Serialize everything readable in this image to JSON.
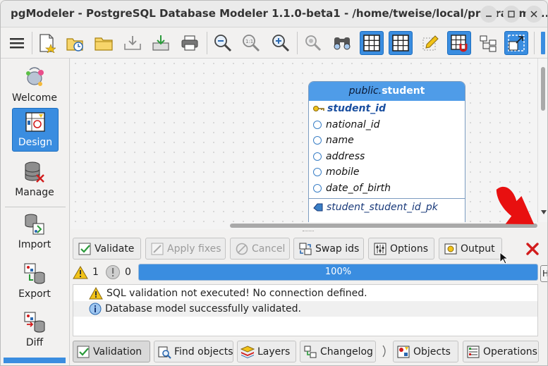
{
  "window": {
    "title": "pgModeler - PostgreSQL Database Modeler 1.1.0-beta1 - /home/tweise/local/programmin...",
    "controls": [
      "minimize",
      "maximize",
      "close"
    ]
  },
  "toolbar": {
    "icons": [
      "menu-icon",
      "new-model-icon",
      "open-recent-icon",
      "open-folder-icon",
      "save-icon",
      "save-as-icon",
      "print-icon",
      "zoom-out-icon",
      "zoom-reset-icon",
      "zoom-in-icon",
      "magnify-disabled-icon",
      "find-icon",
      "grid-icon",
      "align-grid-icon",
      "pencil-grid-icon",
      "magnet-grid-icon",
      "tree-icon",
      "fullscreen-icon"
    ]
  },
  "sidebar": {
    "items": [
      {
        "label": "Welcome",
        "icon": "welcome-icon",
        "active": false
      },
      {
        "label": "Design",
        "icon": "design-icon",
        "active": true
      },
      {
        "label": "Manage",
        "icon": "manage-icon",
        "active": false
      },
      {
        "label": "Import",
        "icon": "import-icon",
        "active": false
      },
      {
        "label": "Export",
        "icon": "export-icon",
        "active": false
      },
      {
        "label": "Diff",
        "icon": "diff-icon",
        "active": false
      }
    ]
  },
  "table": {
    "schema": "public.",
    "name": "student",
    "columns": [
      {
        "name": "student_id",
        "pk": true
      },
      {
        "name": "national_id",
        "pk": false
      },
      {
        "name": "name",
        "pk": false
      },
      {
        "name": "address",
        "pk": false
      },
      {
        "name": "mobile",
        "pk": false
      },
      {
        "name": "date_of_birth",
        "pk": false
      }
    ],
    "constraint": "student_student_id_pk"
  },
  "validation": {
    "buttons": {
      "validate": "Validate",
      "apply_fixes": "Apply fixes",
      "cancel": "Cancel",
      "swap_ids": "Swap ids",
      "options": "Options",
      "output": "Output"
    },
    "warnings": "1",
    "errors": "0",
    "progress_label": "100%",
    "progress_value": 1.0,
    "tooltip_fragment": "H",
    "messages": [
      {
        "type": "warning",
        "text": "SQL validation not executed! No connection defined."
      },
      {
        "type": "info",
        "text": "Database model successfully validated."
      }
    ]
  },
  "bottom_tabs": {
    "validation": "Validation",
    "find_objects": "Find objects",
    "layers": "Layers",
    "changelog": "Changelog",
    "objects": "Objects",
    "operations": "Operations"
  },
  "colors": {
    "accent": "#3a8de0",
    "table_header": "#4f9ce8",
    "annotation_arrow": "#e81010"
  }
}
